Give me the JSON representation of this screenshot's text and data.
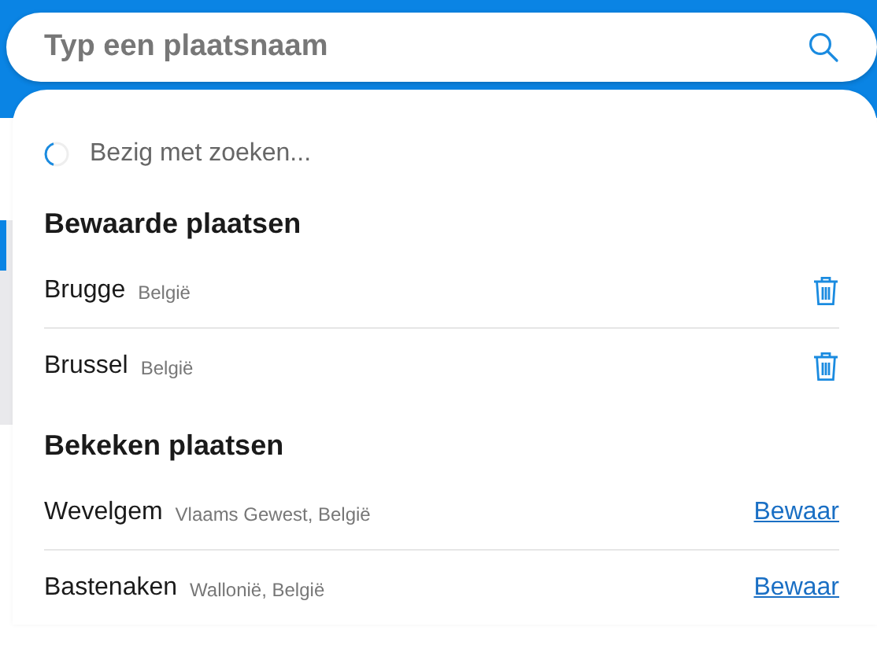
{
  "search": {
    "placeholder": "Typ een plaatsnaam"
  },
  "status": {
    "text": "Bezig met zoeken...",
    "loading": true
  },
  "sections": [
    {
      "title": "Bewaarde plaatsen",
      "places": [
        {
          "kind": "saved",
          "name": "Brugge",
          "region": "België"
        },
        {
          "kind": "saved",
          "name": "Brussel",
          "region": "België"
        }
      ]
    },
    {
      "title": "Bekeken plaatsen",
      "places": [
        {
          "kind": "viewed",
          "name": "Wevelgem",
          "region": "Vlaams Gewest, België",
          "action": "Bewaar"
        },
        {
          "kind": "viewed",
          "name": "Bastenaken",
          "region": "Wallonië, België",
          "action": "Bewaar"
        }
      ]
    }
  ]
}
